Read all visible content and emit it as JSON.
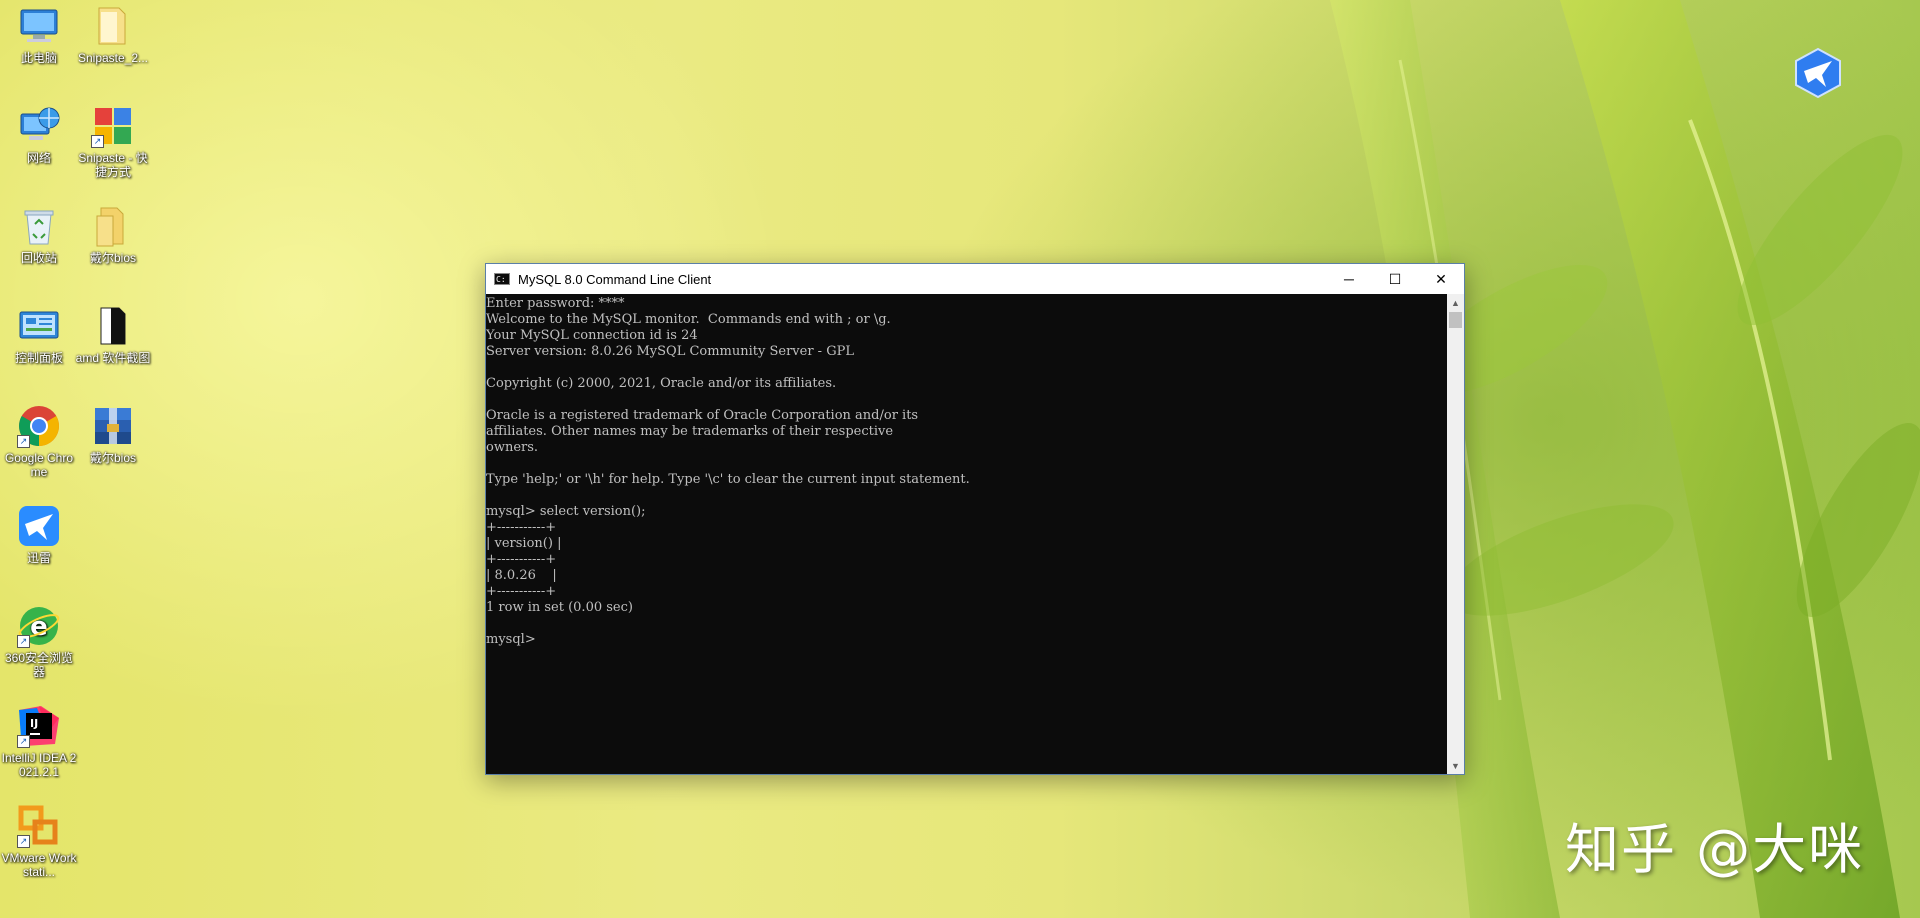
{
  "desktop": {
    "icons": [
      {
        "label": "此电脑"
      },
      {
        "label": "Snipaste_2..."
      },
      {
        "label": "网络"
      },
      {
        "label": "Snipaste - 快捷方式"
      },
      {
        "label": "回收站"
      },
      {
        "label": "戴尔bios"
      },
      {
        "label": "控制面板"
      },
      {
        "label": "amd 软件截图"
      },
      {
        "label": "Google Chrome"
      },
      {
        "label": "戴尔bios"
      },
      {
        "label": "迅雷"
      },
      {
        "label": "360安全浏览器"
      },
      {
        "label": "IntelliJ IDEA 2021.2.1"
      },
      {
        "label": "VMware Workstati..."
      }
    ]
  },
  "window": {
    "title": "MySQL 8.0 Command Line Client",
    "controls": {
      "minimize": "─",
      "maximize": "☐",
      "close": "✕"
    }
  },
  "console": {
    "lines": [
      "Enter password: ****",
      "Welcome to the MySQL monitor.  Commands end with ; or \\g.",
      "Your MySQL connection id is 24",
      "Server version: 8.0.26 MySQL Community Server - GPL",
      "",
      "Copyright (c) 2000, 2021, Oracle and/or its affiliates.",
      "",
      "Oracle is a registered trademark of Oracle Corporation and/or its",
      "affiliates. Other names may be trademarks of their respective",
      "owners.",
      "",
      "Type 'help;' or '\\h' for help. Type '\\c' to clear the current input statement.",
      "",
      "mysql> select version();",
      "+-----------+",
      "| version() |",
      "+-----------+",
      "| 8.0.26    |",
      "+-----------+",
      "1 row in set (0.00 sec)",
      "",
      "mysql>"
    ]
  },
  "scrollbar": {
    "up": "▲",
    "down": "▼"
  },
  "watermark": "知乎 @大咪"
}
